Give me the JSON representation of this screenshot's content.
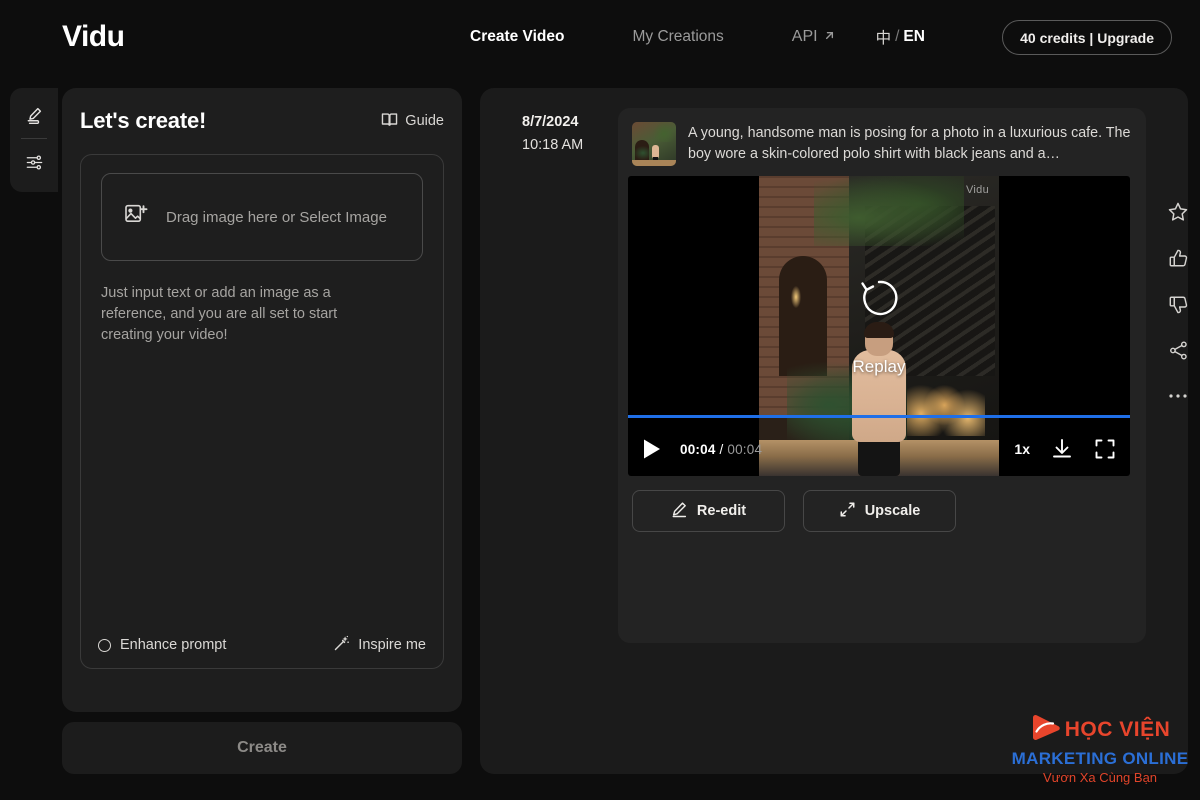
{
  "header": {
    "brand": "Vidu",
    "nav": [
      {
        "label": "Create Video",
        "state": "active"
      },
      {
        "label": "My Creations",
        "state": "dim"
      },
      {
        "label": "API",
        "state": "dim",
        "icon": "arrow-up-right-icon"
      }
    ],
    "language": {
      "zh": "中",
      "separator": "/",
      "en": "EN"
    },
    "credits_label": "40 credits | Upgrade"
  },
  "rail": {
    "items": [
      {
        "name": "edit-icon"
      },
      {
        "name": "sliders-icon"
      }
    ]
  },
  "left_panel": {
    "title": "Let's create!",
    "guide_label": "Guide",
    "drop_zone_label": "Drag image here or Select Image",
    "hint": "Just input text or add an image as a reference, and you are all set to start creating your video!",
    "enhance_label": "Enhance prompt",
    "inspire_label": "Inspire me",
    "create_label": "Create"
  },
  "generation": {
    "date": "8/7/2024",
    "time": "10:18 AM",
    "prompt": "A young, handsome man is posing for a photo in a luxurious cafe. The boy wore a skin-colored polo shirt with black jeans and a…",
    "video": {
      "watermark": "Vidu",
      "replay_label": "Replay",
      "current_time": "00:04",
      "time_separator": "/",
      "duration": "00:04",
      "speed": "1x",
      "progress_percent": 100
    },
    "actions": [
      {
        "label": "Re-edit",
        "icon": "pencil-icon"
      },
      {
        "label": "Upscale",
        "icon": "expand-icon"
      }
    ],
    "side_actions": [
      {
        "name": "star-icon"
      },
      {
        "name": "thumbs-up-icon"
      },
      {
        "name": "thumbs-down-icon"
      },
      {
        "name": "share-icon"
      },
      {
        "name": "more-icon"
      }
    ]
  },
  "watermark": {
    "line1": "HỌC VIỆN",
    "line2": "MARKETING ONLINE",
    "line3": "Vươn Xa Cùng Bạn"
  },
  "colors": {
    "page_bg": "#0d0d0d",
    "panel_bg": "#1e1e1e",
    "card_bg": "#232323",
    "accent_blue": "#1f6fe8",
    "wm_red": "#e8452c",
    "wm_blue": "#2b6fd6"
  }
}
